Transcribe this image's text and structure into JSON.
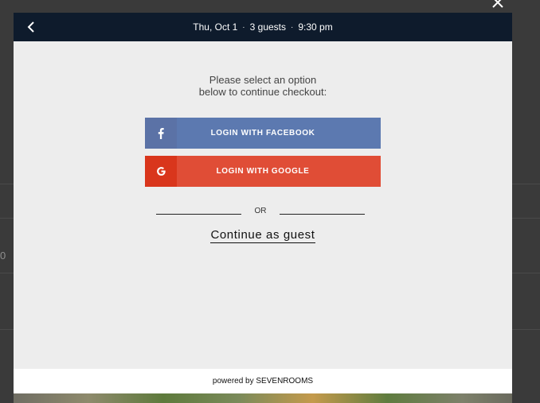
{
  "background": {
    "fragment": "0"
  },
  "topbar": {
    "date": "Thu, Oct 1",
    "guests": "3 guests",
    "time": "9:30 pm",
    "separator": "·"
  },
  "prompt": {
    "line1": "Please select an option",
    "line2": "below to continue checkout:"
  },
  "buttons": {
    "facebook": {
      "label": "LOGIN WITH FACEBOOK",
      "icon": "facebook-icon",
      "color": "#5c79b0"
    },
    "google": {
      "label": "LOGIN WITH GOOGLE",
      "icon": "google-icon",
      "color": "#e04d36"
    }
  },
  "divider": {
    "label": "OR"
  },
  "guest_link": "Continue as guest",
  "footer": {
    "text": "powered by SEVENROOMS"
  },
  "colors": {
    "topbar": "#0e1b2c",
    "modal": "#ededed",
    "overlay": "#3a3a3a"
  }
}
